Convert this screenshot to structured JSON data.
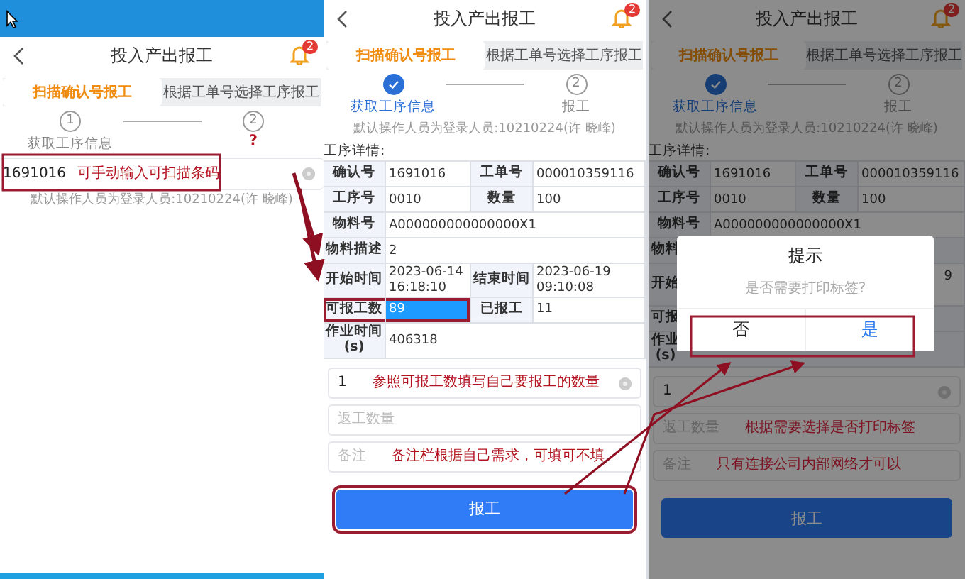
{
  "screens": [
    {
      "kind": "scan",
      "title": "投入产出报工",
      "badge": "2",
      "tabs": [
        {
          "label": "扫描确认号报工",
          "selected": true
        },
        {
          "label": "根据工单号选择工序报工",
          "selected": false
        }
      ],
      "steps": [
        {
          "number": "1",
          "label": "获取工序信息",
          "done": false,
          "flagged": false
        },
        {
          "number": "2",
          "label": "?",
          "done": false,
          "flagged": true
        }
      ],
      "scan_field": {
        "value": "1691016",
        "annotation": "可手动输入可扫描条码"
      },
      "operator_note": "默认操作人员为登录人员:10210224(许 晓峰)"
    },
    {
      "kind": "detail",
      "title": "投入产出报工",
      "badge": "2",
      "tabs": [
        {
          "label": "扫描确认号报工",
          "selected": true
        },
        {
          "label": "根据工单号选择工序报工",
          "selected": false
        }
      ],
      "steps": [
        {
          "label": "获取工序信息",
          "done": true,
          "flagged": false
        },
        {
          "number": "2",
          "label": "报工",
          "done": false,
          "flagged": false
        }
      ],
      "operator_note": "默认操作人员为登录人员:10210224(许 晓峰)",
      "section_label": "工序详情:",
      "details": [
        [
          {
            "kind": "label",
            "text": "确认号"
          },
          {
            "kind": "value",
            "text": "1691016"
          },
          {
            "kind": "label",
            "text": "工单号"
          },
          {
            "kind": "value",
            "text": "000010359116"
          }
        ],
        [
          {
            "kind": "label",
            "text": "工序号"
          },
          {
            "kind": "value",
            "text": "0010"
          },
          {
            "kind": "label",
            "text": "数量"
          },
          {
            "kind": "value",
            "text": "100"
          }
        ],
        [
          {
            "kind": "label",
            "text": "物料号"
          },
          {
            "kind": "wide",
            "text": "A000000000000000X1"
          }
        ],
        [
          {
            "kind": "label",
            "text": "物料描述"
          },
          {
            "kind": "wide",
            "text": "2"
          }
        ],
        [
          {
            "kind": "label",
            "text": "开始时间"
          },
          {
            "kind": "value",
            "text": "2023-06-14\n16:18:10"
          },
          {
            "kind": "label",
            "text": "结束时间"
          },
          {
            "kind": "value",
            "text": "2023-06-19\n09:10:08"
          }
        ],
        [
          {
            "kind": "label",
            "text": "可报工数"
          },
          {
            "kind": "selected_value",
            "text": "89"
          },
          {
            "kind": "label",
            "text": "已报工"
          },
          {
            "kind": "value",
            "text": "11"
          }
        ],
        [
          {
            "kind": "label",
            "text": "作业时间\n(s)"
          },
          {
            "kind": "wide",
            "text": "406318"
          }
        ]
      ],
      "fields": [
        {
          "value": "1",
          "annotation": "参照可报工数填写自己要报工的数量"
        },
        {
          "placeholder": "返工数量"
        },
        {
          "placeholder": "备注",
          "annotation": "备注栏根据自己需求，可填可不填"
        }
      ],
      "submit": "报工"
    },
    {
      "kind": "detail",
      "title": "投入产出报工",
      "badge": "2",
      "tabs": [
        {
          "label": "扫描确认号报工",
          "selected": true
        },
        {
          "label": "根据工单号选择工序报工",
          "selected": false
        }
      ],
      "steps": [
        {
          "label": "获取工序信息",
          "done": true,
          "flagged": false
        },
        {
          "number": "2",
          "label": "报工",
          "done": false,
          "flagged": false
        }
      ],
      "operator_note": "默认操作人员为登录人员:10210224(许 晓峰)",
      "section_label": "工序详情:",
      "details": [
        [
          {
            "kind": "label",
            "text": "确认号"
          },
          {
            "kind": "value",
            "text": "1691016"
          },
          {
            "kind": "label",
            "text": "工单号"
          },
          {
            "kind": "value",
            "text": "000010359116"
          }
        ],
        [
          {
            "kind": "label",
            "text": "工序号"
          },
          {
            "kind": "value",
            "text": "0010"
          },
          {
            "kind": "label",
            "text": "数量"
          },
          {
            "kind": "value",
            "text": "100"
          }
        ],
        [
          {
            "kind": "label",
            "text": "物料号"
          },
          {
            "kind": "wide",
            "text": "A000000000000000X1"
          }
        ],
        [
          {
            "kind": "cut_label",
            "text": "物料"
          }
        ],
        [
          {
            "kind": "cut_label",
            "text": "开始"
          },
          {
            "kind": "edge_value",
            "text": "9"
          }
        ],
        [
          {
            "kind": "cut_label",
            "text": "可报"
          }
        ],
        [
          {
            "kind": "cut_label",
            "text": "作业\n(s)"
          }
        ]
      ],
      "fields": [
        {
          "value": "1"
        },
        {
          "placeholder": "返工数量",
          "annotation": "根据需要选择是否打印标签"
        },
        {
          "placeholder": "备注",
          "annotation": "只有连接公司内部网络才可以"
        }
      ],
      "submit": "报工",
      "dialog": {
        "title": "提示",
        "message": "是否需要打印标签?",
        "buttons": [
          {
            "label": "否",
            "primary": false
          },
          {
            "label": "是",
            "primary": true
          }
        ]
      }
    }
  ]
}
